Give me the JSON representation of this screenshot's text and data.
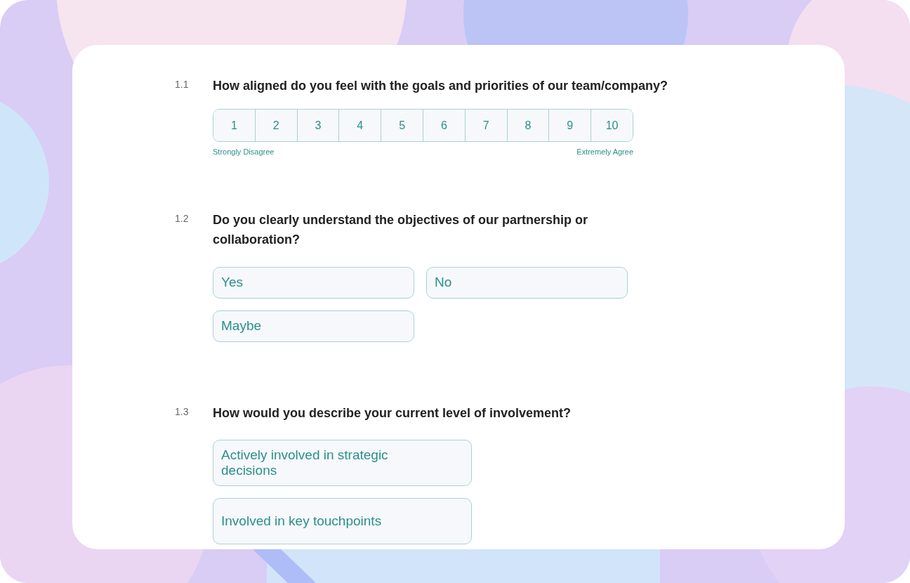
{
  "questions": [
    {
      "number": "1.1",
      "text": "How aligned do you feel with the goals and priorities of our team/company?",
      "kind": "scale",
      "options": [
        {
          "label": "1",
          "selected": false
        },
        {
          "label": "2",
          "selected": false
        },
        {
          "label": "3",
          "selected": false
        },
        {
          "label": "4",
          "selected": false
        },
        {
          "label": "5",
          "selected": false
        },
        {
          "label": "6",
          "selected": false
        },
        {
          "label": "7",
          "selected": false
        },
        {
          "label": "8",
          "selected": false
        },
        {
          "label": "9",
          "selected": false
        },
        {
          "label": "10",
          "selected": false
        }
      ],
      "low_label": "Strongly Disagree",
      "high_label": "Extremely Agree"
    },
    {
      "number": "1.2",
      "text": "Do you clearly understand the objectives of our partnership or collaboration?",
      "kind": "choice",
      "options": [
        {
          "label": "Yes",
          "selected": false
        },
        {
          "label": "No",
          "selected": false
        },
        {
          "label": "Maybe",
          "selected": false
        }
      ]
    },
    {
      "number": "1.3",
      "text": "How would you describe your current level of involvement?",
      "kind": "tall-choice",
      "options": [
        {
          "label": "Actively involved in strategic decisions",
          "selected": false
        },
        {
          "label": "Involved in key touchpoints",
          "selected": false
        }
      ]
    }
  ]
}
